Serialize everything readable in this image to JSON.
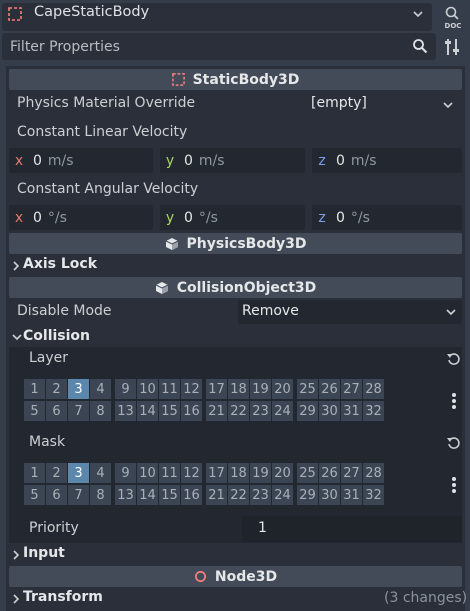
{
  "node_bar": {
    "node_name": "CapeStaticBody",
    "doc_icon": "doc-icon"
  },
  "filter": {
    "placeholder": "Filter Properties"
  },
  "static_body": {
    "header": "StaticBody3D",
    "physics_material_label": "Physics Material Override",
    "physics_material_value": "[empty]",
    "linear_label": "Constant Linear Velocity",
    "linear": [
      {
        "axis": "x",
        "value": "0",
        "unit": "m/s"
      },
      {
        "axis": "y",
        "value": "0",
        "unit": "m/s"
      },
      {
        "axis": "z",
        "value": "0",
        "unit": "m/s"
      }
    ],
    "angular_label": "Constant Angular Velocity",
    "angular": [
      {
        "axis": "x",
        "value": "0",
        "unit": "°/s"
      },
      {
        "axis": "y",
        "value": "0",
        "unit": "°/s"
      },
      {
        "axis": "z",
        "value": "0",
        "unit": "°/s"
      }
    ]
  },
  "physics_body": {
    "header": "PhysicsBody3D",
    "axis_lock": "Axis Lock"
  },
  "collision_object": {
    "header": "CollisionObject3D",
    "disable_mode_label": "Disable Mode",
    "disable_mode_value": "Remove",
    "collision_title": "Collision",
    "layer_label": "Layer",
    "mask_label": "Mask",
    "layer_bits": [
      "1",
      "2",
      "3",
      "4",
      "9",
      "10",
      "11",
      "12",
      "17",
      "18",
      "19",
      "20",
      "25",
      "26",
      "27",
      "28",
      "5",
      "6",
      "7",
      "8",
      "13",
      "14",
      "15",
      "16",
      "21",
      "22",
      "23",
      "24",
      "29",
      "30",
      "31",
      "32"
    ],
    "mask_bits": [
      "1",
      "2",
      "3",
      "4",
      "9",
      "10",
      "11",
      "12",
      "17",
      "18",
      "19",
      "20",
      "25",
      "26",
      "27",
      "28",
      "5",
      "6",
      "7",
      "8",
      "13",
      "14",
      "15",
      "16",
      "21",
      "22",
      "23",
      "24",
      "29",
      "30",
      "31",
      "32"
    ],
    "layer_enabled": [
      "3"
    ],
    "mask_enabled": [
      "3"
    ],
    "priority_label": "Priority",
    "priority_value": "1",
    "input_title": "Input"
  },
  "node3d": {
    "header": "Node3D",
    "transform": "Transform",
    "changes": "(3 changes)"
  },
  "colors": {
    "x_axis": "#e0786e",
    "y_axis": "#a9d46b",
    "z_axis": "#7ba0e6",
    "static_body_icon": "#fc7f7f",
    "node3d_icon": "#fc7f7f",
    "bit_on": "#5b87ad"
  }
}
